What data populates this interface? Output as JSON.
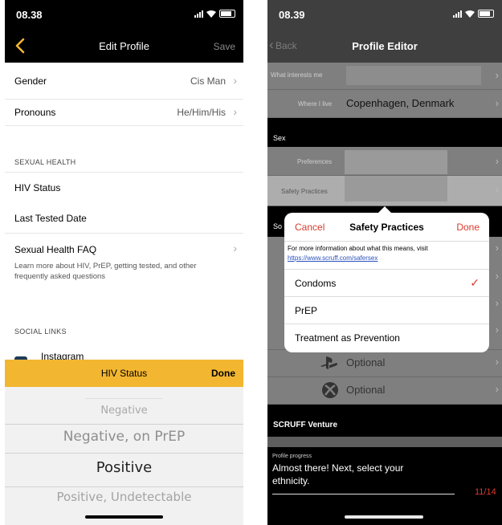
{
  "left": {
    "status_time": "08.38",
    "nav": {
      "title": "Edit Profile",
      "save_label": "Save"
    },
    "rows": {
      "gender": {
        "label": "Gender",
        "value": "Cis Man"
      },
      "pronouns": {
        "label": "Pronouns",
        "value": "He/Him/His"
      }
    },
    "sexual_health": {
      "section": "SEXUAL HEALTH",
      "hiv_status": "HIV Status",
      "last_tested": "Last Tested Date",
      "faq_title": "Sexual Health FAQ",
      "faq_desc": "Learn more about HIV, PrEP, getting tested, and other frequently asked questions"
    },
    "social": {
      "section": "SOCIAL LINKS",
      "instagram": "Instagram"
    },
    "picker": {
      "title": "HIV Status",
      "done_label": "Done",
      "options": [
        "Negative",
        "Negative, on PrEP",
        "Positive",
        "Positive, Undetectable"
      ],
      "selected": "Positive"
    }
  },
  "right": {
    "status_time": "08.39",
    "nav": {
      "back_label": "Back",
      "title": "Profile Editor"
    },
    "rows": {
      "interests": "What interests me",
      "where_label": "Where I live",
      "where_value": "Copenhagen, Denmark",
      "preferences": "Preferences",
      "safety": "Safety Practices"
    },
    "sections": {
      "sex": "Sex",
      "so_partial": "So",
      "venture": "SCRUFF Venture"
    },
    "optional_1": "Optional",
    "optional_2": "Optional",
    "sheet": {
      "cancel_label": "Cancel",
      "title": "Safety Practices",
      "done_label": "Done",
      "info_text": "For more information about what this means, visit",
      "link_text": "https://www.scruff.com/safersex",
      "options": [
        {
          "label": "Condoms",
          "checked": true
        },
        {
          "label": "PrEP",
          "checked": false
        },
        {
          "label": "Treatment as Prevention",
          "checked": false
        }
      ]
    },
    "progress": {
      "label": "Profile progress",
      "message": "Almost there! Next, select your ethnicity.",
      "count": "11/14"
    }
  },
  "colors": {
    "accent_yellow": "#f2b630",
    "accent_red": "#d93a2e",
    "link_blue": "#2a52be"
  }
}
